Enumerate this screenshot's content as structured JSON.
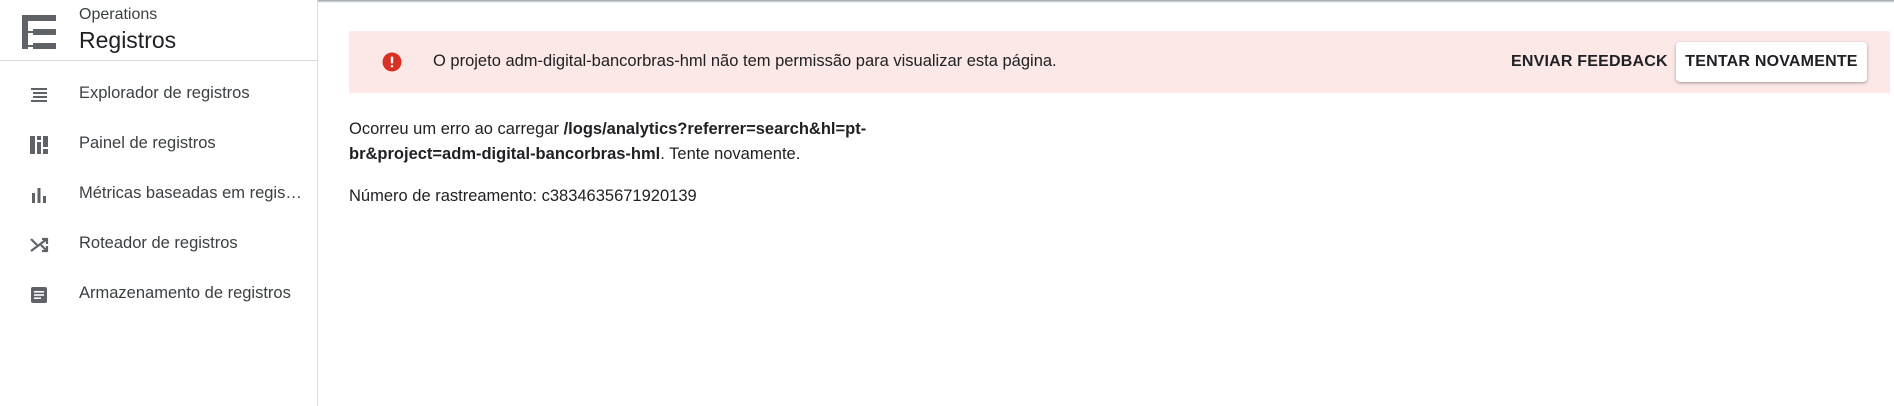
{
  "sidebar": {
    "kicker": "Operations",
    "title": "Registros",
    "items": [
      {
        "label": "Explorador de registros",
        "icon": "list-icon"
      },
      {
        "label": "Painel de registros",
        "icon": "dashboard-icon"
      },
      {
        "label": "Métricas baseadas em registros",
        "icon": "bar-chart-icon"
      },
      {
        "label": "Roteador de registros",
        "icon": "shuffle-icon"
      },
      {
        "label": "Armazenamento de registros",
        "icon": "storage-icon"
      }
    ]
  },
  "banner": {
    "message": "O projeto adm-digital-bancorbras-hml não tem permissão para visualizar esta página.",
    "feedback_label": "ENVIAR FEEDBACK",
    "retry_label": "TENTAR NOVAMENTE",
    "icon": "error-icon"
  },
  "error": {
    "prefix": "Ocorreu um erro ao carregar ",
    "path": "/logs/analytics?referrer=search&hl=pt-br&project=adm-digital-bancorbras-hml",
    "suffix": ". Tente novamente.",
    "trace_label": "Número de rastreamento: ",
    "trace_id": "c3834635671920139"
  },
  "colors": {
    "banner_bg": "#fce8e6",
    "error_red": "#d93025",
    "icon_gray": "#5f6368",
    "divider": "#dadce0"
  }
}
